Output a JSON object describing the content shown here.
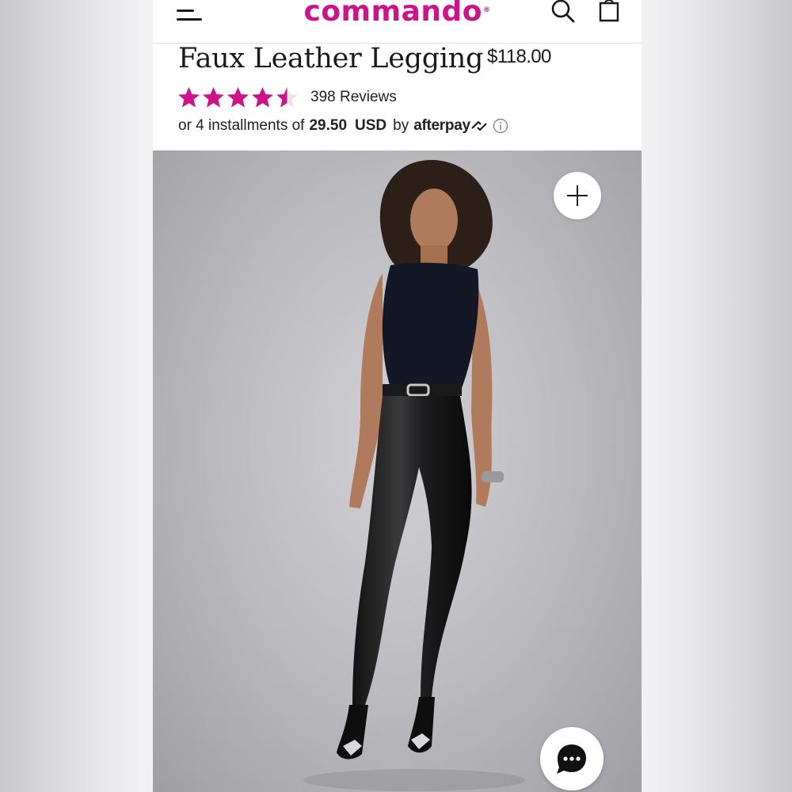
{
  "header": {
    "logo_text": "commando",
    "logo_mark": "®",
    "menu_icon": "hamburger-menu-icon",
    "search_icon": "search-icon",
    "bag_icon": "shopping-bag-icon",
    "brand_color": "#d1118a"
  },
  "product": {
    "title": "Faux Leather Legging",
    "price": "$118.00",
    "rating": 4.5,
    "rating_max": 5,
    "reviews_label": "398 Reviews",
    "star_color": "#d1118a"
  },
  "afterpay": {
    "prefix": "or 4 installments of",
    "amount": "29.50",
    "currency": "USD",
    "by": "by",
    "brand": "afterpay",
    "info_icon": "info-icon"
  },
  "gallery": {
    "zoom_icon": "plus-icon",
    "chat_icon": "chat-icon"
  }
}
